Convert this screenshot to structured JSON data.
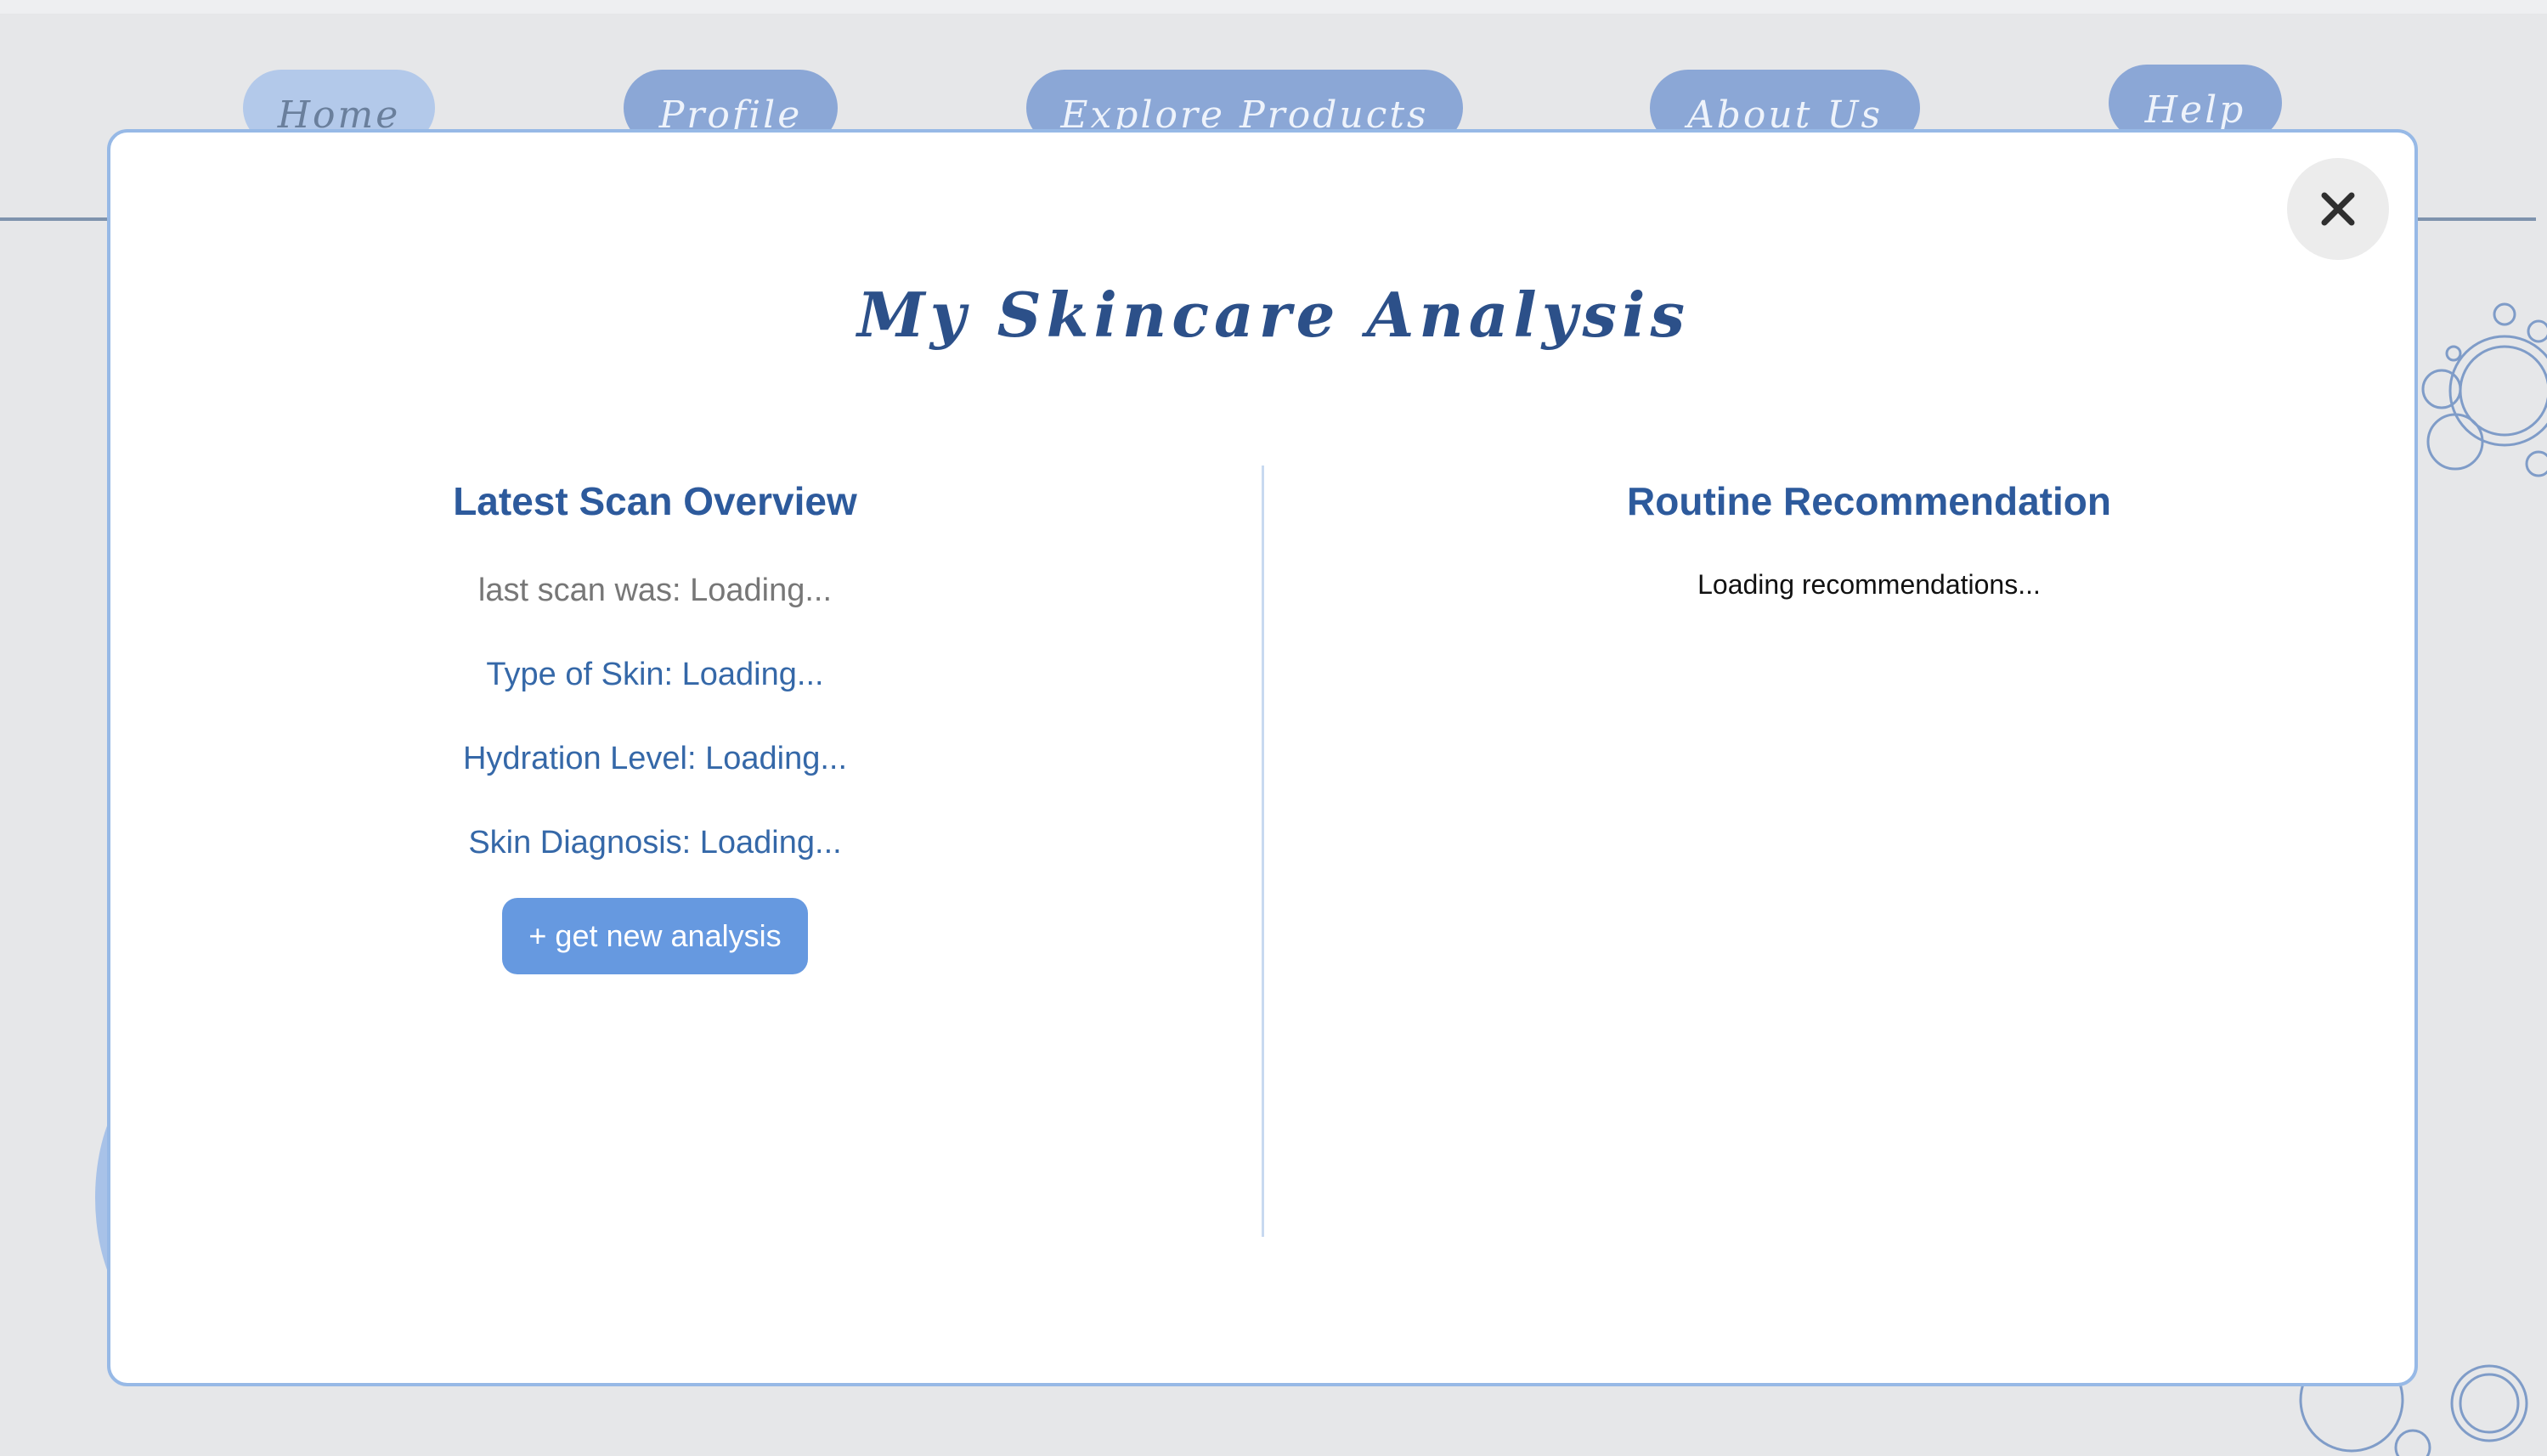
{
  "nav": {
    "items": [
      {
        "label": "Home"
      },
      {
        "label": "Profile"
      },
      {
        "label": "Explore Products"
      },
      {
        "label": "About Us"
      },
      {
        "label": "Help"
      }
    ],
    "active": "Home"
  },
  "modal": {
    "title": "My Skincare Analysis",
    "close_icon": "close-icon",
    "left": {
      "heading": "Latest Scan Overview",
      "last_scan": "last scan was: Loading...",
      "skin_type": "Type of Skin: Loading...",
      "hydration": "Hydration Level: Loading...",
      "diagnosis": "Skin Diagnosis: Loading...",
      "new_analysis_button": "+ get new analysis"
    },
    "right": {
      "heading": "Routine Recommendation",
      "loading_text": "Loading recommendations..."
    }
  },
  "colors": {
    "background": "#e6e7e9",
    "nav_button": "#8ba7d6",
    "nav_button_active": "#b3c9ea",
    "heading": "#2d5a9c",
    "title": "#2c5089",
    "accent_button": "#6699e0",
    "modal_border": "#97b9e6"
  }
}
